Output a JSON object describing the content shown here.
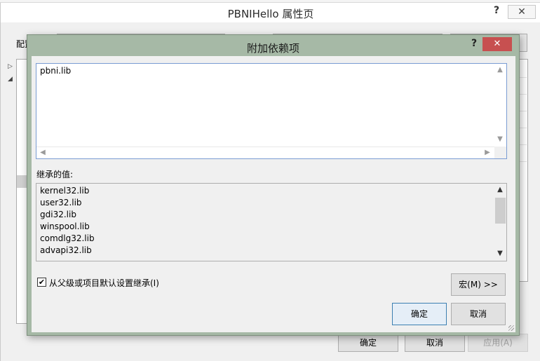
{
  "outer_window": {
    "title": "PBNIHello 属性页",
    "config_label": "配置",
    "help_label": "?",
    "close_label": "✕",
    "ok_label": "确定",
    "cancel_label": "取消",
    "apply_label": "应用(A)"
  },
  "dialog": {
    "title": "附加依赖项",
    "help_label": "?",
    "close_label": "✕",
    "edit_text": "pbni.lib",
    "inherited_label": "继承的值:",
    "inherited_values": [
      "kernel32.lib",
      "user32.lib",
      "gdi32.lib",
      "winspool.lib",
      "comdlg32.lib",
      "advapi32.lib"
    ],
    "inherit_checkbox_label": "从父级或项目默认设置继承(I)",
    "inherit_checked": true,
    "macro_button": "宏(M) >>",
    "ok_button": "确定",
    "cancel_button": "取消"
  },
  "colors": {
    "dialog_frame": "#a6b9a6",
    "close_button": "#c75050",
    "focus_border": "#7a9cd3"
  },
  "icons": {
    "scroll_up": "▲",
    "scroll_down": "▼",
    "scroll_left": "◀",
    "scroll_right": "▶",
    "checkmark": "✔"
  }
}
